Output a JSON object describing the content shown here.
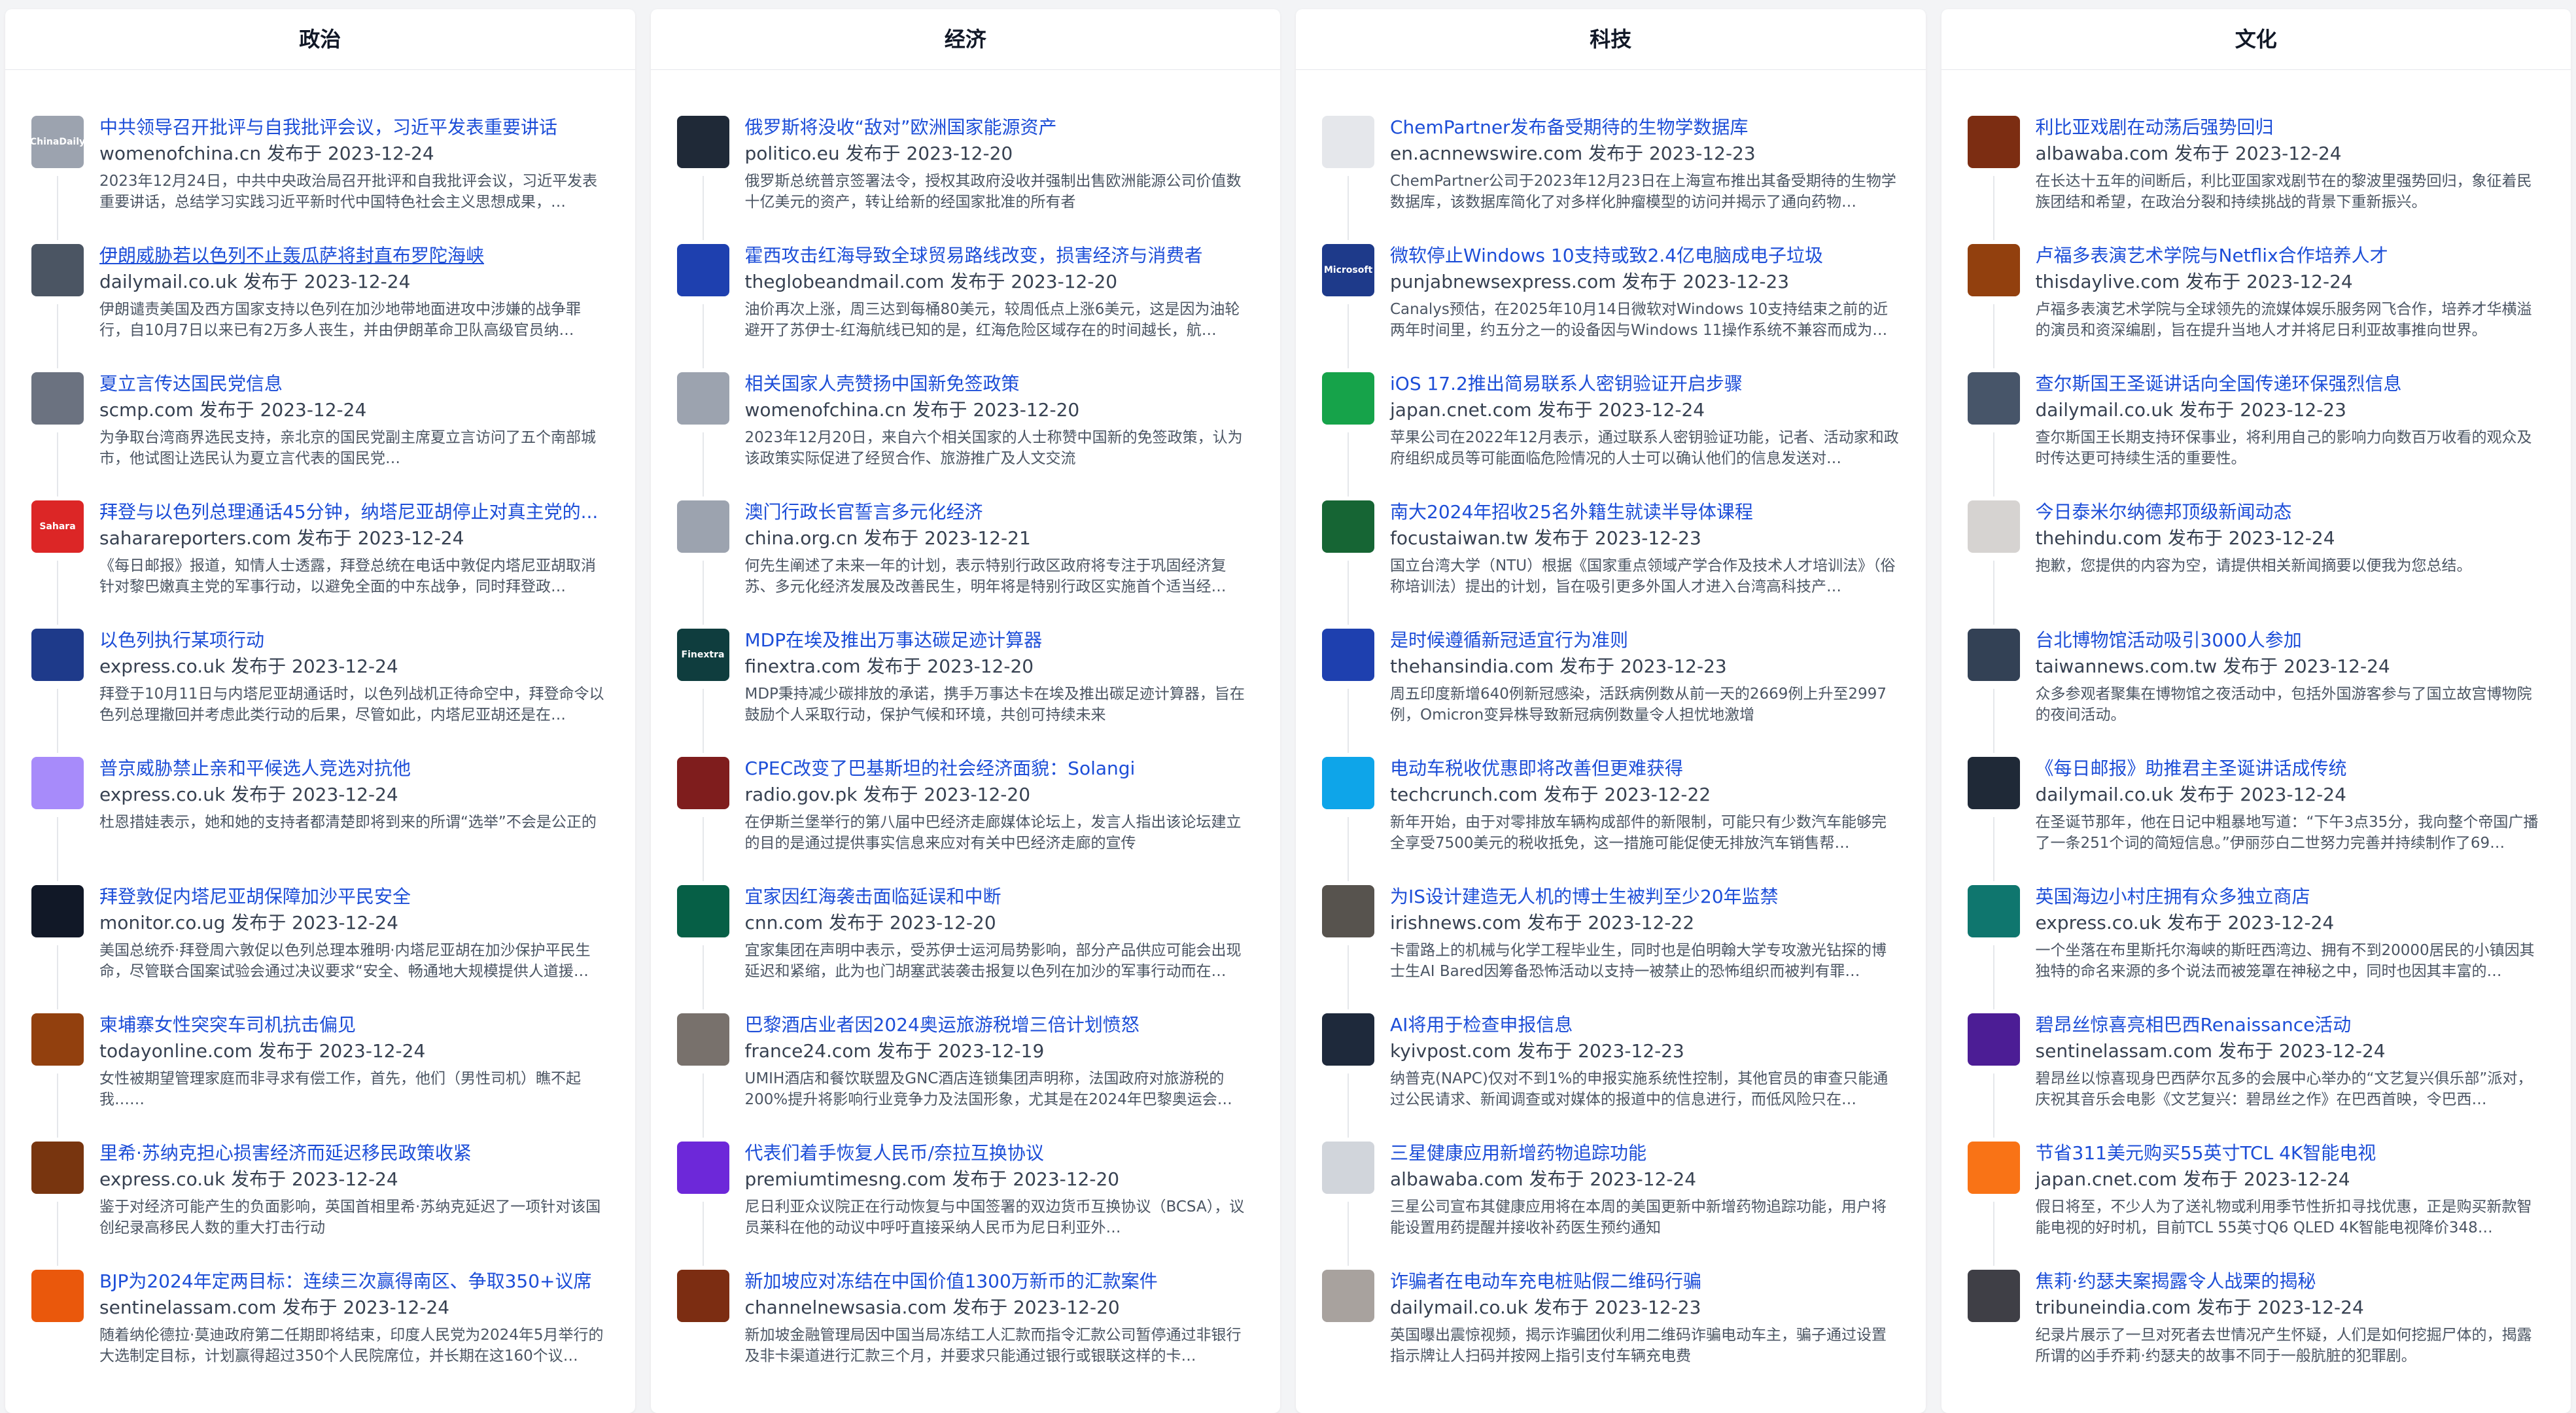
{
  "columns": [
    {
      "title": "政治",
      "items": [
        {
          "title": "中共领导召开批评与自我批评会议，习近平发表重要讲话",
          "source": "womenofchina.cn",
          "date_prefix": "发布于",
          "date": "2023-12-24",
          "summary": "2023年12月24日，中共中央政治局召开批评和自我批评会议，习近平发表重要讲话，总结学习实践习近平新时代中国特色社会主义思想成果，…",
          "thumb_color": "#9ca3af",
          "thumb_text": "ChinaDaily"
        },
        {
          "title": "伊朗威胁若以色列不止轰瓜萨将封直布罗陀海峡",
          "source": "dailymail.co.uk",
          "date_prefix": "发布于",
          "date": "2023-12-24",
          "summary": "伊朗谴责美国及西方国家支持以色列在加沙地带地面进攻中涉嫌的战争罪行，自10月7日以来已有2万多人丧生，并由伊朗革命卫队高级官员纳…",
          "thumb_color": "#4b5563",
          "thumb_text": ""
        },
        {
          "title": "夏立言传达国民党信息",
          "source": "scmp.com",
          "date_prefix": "发布于",
          "date": "2023-12-24",
          "summary": "为争取台湾商界选民支持，亲北京的国民党副主席夏立言访问了五个南部城市，他试图让选民认为夏立言代表的国民党…",
          "thumb_color": "#6b7280",
          "thumb_text": ""
        },
        {
          "title": "拜登与以色列总理通话45分钟，纳塔尼亚胡停止对真主党的...",
          "source": "saharareporters.com",
          "date_prefix": "发布于",
          "date": "2023-12-24",
          "summary": "《每日邮报》报道，知情人士透露，拜登总统在电话中敦促内塔尼亚胡取消针对黎巴嫩真主党的军事行动，以避免全面的中东战争，同时拜登政…",
          "thumb_color": "#dc2626",
          "thumb_text": "Sahara"
        },
        {
          "title": "以色列执行某项行动",
          "source": "express.co.uk",
          "date_prefix": "发布于",
          "date": "2023-12-24",
          "summary": "拜登于10月11日与内塔尼亚胡通话时，以色列战机正待命空中，拜登命令以色列总理撤回并考虑此类行动的后果，尽管如此，内塔尼亚胡还是在…",
          "thumb_color": "#1e3a8a",
          "thumb_text": ""
        },
        {
          "title": "普京威胁禁止亲和平候选人竞选对抗他",
          "source": "express.co.uk",
          "date_prefix": "发布于",
          "date": "2023-12-24",
          "summary": "杜恩措娃表示，她和她的支持者都清楚即将到来的所谓“选举”不会是公正的",
          "thumb_color": "#a78bfa",
          "thumb_text": ""
        },
        {
          "title": "拜登敦促内塔尼亚胡保障加沙平民安全",
          "source": "monitor.co.ug",
          "date_prefix": "发布于",
          "date": "2023-12-24",
          "summary": "美国总统乔·拜登周六敦促以色列总理本雅明·内塔尼亚胡在加沙保护平民生命，尽管联合国案试验会通过决议要求“安全、畅通地大规模提供人道援…",
          "thumb_color": "#111827",
          "thumb_text": ""
        },
        {
          "title": "柬埔寨女性突突车司机抗击偏见",
          "source": "todayonline.com",
          "date_prefix": "发布于",
          "date": "2023-12-24",
          "summary": "女性被期望管理家庭而非寻求有偿工作，首先，他们（男性司机）瞧不起我……",
          "thumb_color": "#92400e",
          "thumb_text": ""
        },
        {
          "title": "里希·苏纳克担心损害经济而延迟移民政策收紧",
          "source": "express.co.uk",
          "date_prefix": "发布于",
          "date": "2023-12-24",
          "summary": "鉴于对经济可能产生的负面影响，英国首相里希·苏纳克延迟了一项针对该国创纪录高移民人数的重大打击行动",
          "thumb_color": "#78350f",
          "thumb_text": ""
        },
        {
          "title": "BJP为2024年定两目标：连续三次赢得南区、争取350+议席",
          "source": "sentinelassam.com",
          "date_prefix": "发布于",
          "date": "2023-12-24",
          "summary": "随着纳伦德拉·莫迪政府第二任期即将结束，印度人民党为2024年5月举行的大选制定目标，计划赢得超过350个人民院席位，并长期在这160个议…",
          "thumb_color": "#ea580c",
          "thumb_text": ""
        }
      ]
    },
    {
      "title": "经济",
      "items": [
        {
          "title": "俄罗斯将没收“敌对”欧洲国家能源资产",
          "source": "politico.eu",
          "date_prefix": "发布于",
          "date": "2023-12-20",
          "summary": "俄罗斯总统普京签署法令，授权其政府没收并强制出售欧洲能源公司价值数十亿美元的资产，转让给新的经国家批准的所有者",
          "thumb_color": "#1f2937",
          "thumb_text": ""
        },
        {
          "title": "霍西攻击红海导致全球贸易路线改变，损害经济与消费者",
          "source": "theglobeandmail.com",
          "date_prefix": "发布于",
          "date": "2023-12-20",
          "summary": "油价再次上涨，周三达到每桶80美元，较周低点上涨6美元，这是因为油轮避开了苏伊士-红海航线已知的是，红海危险区域存在的时间越长，航…",
          "thumb_color": "#1e40af",
          "thumb_text": ""
        },
        {
          "title": "相关国家人壳赞扬中国新免签政策",
          "source": "womenofchina.cn",
          "date_prefix": "发布于",
          "date": "2023-12-20",
          "summary": "2023年12月20日，来自六个相关国家的人士称赞中国新的免签政策，认为该政策实际促进了经贸合作、旅游推广及人文交流",
          "thumb_color": "#9ca3af",
          "thumb_text": ""
        },
        {
          "title": "澳门行政长官誓言多元化经济",
          "source": "china.org.cn",
          "date_prefix": "发布于",
          "date": "2023-12-21",
          "summary": "何先生阐述了未来一年的计划，表示特别行政区政府将专注于巩固经济复苏、多元化经济发展及改善民生，明年将是特别行政区实施首个适当经…",
          "thumb_color": "#9ca3af",
          "thumb_text": ""
        },
        {
          "title": "MDP在埃及推出万事达碳足迹计算器",
          "source": "finextra.com",
          "date_prefix": "发布于",
          "date": "2023-12-20",
          "summary": "MDP秉持减少碳排放的承诺，携手万事达卡在埃及推出碳足迹计算器，旨在鼓励个人采取行动，保护气候和环境，共创可持续未来",
          "thumb_color": "#0f3d3e",
          "thumb_text": "Finextra"
        },
        {
          "title": "CPEC改变了巴基斯坦的社会经济面貌：Solangi",
          "source": "radio.gov.pk",
          "date_prefix": "发布于",
          "date": "2023-12-20",
          "summary": "在伊斯兰堡举行的第八届中巴经济走廊媒体论坛上，发言人指出该论坛建立的目的是通过提供事实信息来应对有关中巴经济走廊的宣传",
          "thumb_color": "#7f1d1d",
          "thumb_text": ""
        },
        {
          "title": "宜家因红海袭击面临延误和中断",
          "source": "cnn.com",
          "date_prefix": "发布于",
          "date": "2023-12-20",
          "summary": "宜家集团在声明中表示，受苏伊士运河局势影响，部分产品供应可能会出现延迟和紧缩，此为也门胡塞武装袭击报复以色列在加沙的军事行动而在…",
          "thumb_color": "#065f46",
          "thumb_text": ""
        },
        {
          "title": "巴黎酒店业者因2024奥运旅游税增三倍计划愤怒",
          "source": "france24.com",
          "date_prefix": "发布于",
          "date": "2023-12-19",
          "summary": "UMIH酒店和餐饮联盟及GNC酒店连锁集团声明称，法国政府对旅游税的200%提升将影响行业竞争力及法国形象，尤其是在2024年巴黎奥运会…",
          "thumb_color": "#78716c",
          "thumb_text": ""
        },
        {
          "title": "代表们着手恢复人民币/奈拉互换协议",
          "source": "premiumtimesng.com",
          "date_prefix": "发布于",
          "date": "2023-12-20",
          "summary": "尼日利亚众议院正在行动恢复与中国签署的双边货币互换协议（BCSA），议员莱科在他的动议中呼吁直接采纳人民币为尼日利亚外…",
          "thumb_color": "#6d28d9",
          "thumb_text": ""
        },
        {
          "title": "新加坡应对冻结在中国价值1300万新币的汇款案件",
          "source": "channelnewsasia.com",
          "date_prefix": "发布于",
          "date": "2023-12-20",
          "summary": "新加坡金融管理局因中国当局冻结工人汇款而指令汇款公司暂停通过非银行及非卡渠道进行汇款三个月，并要求只能通过银行或银联这样的卡…",
          "thumb_color": "#7c2d12",
          "thumb_text": ""
        }
      ]
    },
    {
      "title": "科技",
      "items": [
        {
          "title": "ChemPartner发布备受期待的生物学数据库",
          "source": "en.acnnewswire.com",
          "date_prefix": "发布于",
          "date": "2023-12-23",
          "summary": "ChemPartner公司于2023年12月23日在上海宣布推出其备受期待的生物学数据库，该数据库简化了对多样化肿瘤模型的访问并揭示了通向药物…",
          "thumb_color": "#e5e7eb",
          "thumb_text": ""
        },
        {
          "title": "微软停止Windows 10支持或致2.4亿电脑成电子垃圾",
          "source": "punjabnewsexpress.com",
          "date_prefix": "发布于",
          "date": "2023-12-23",
          "summary": "Canalys预估，在2025年10月14日微软对Windows 10支持结束之前的近两年时间里，约五分之一的设备因与Windows 11操作系统不兼容而成为…",
          "thumb_color": "#1e3a8a",
          "thumb_text": "Microsoft"
        },
        {
          "title": "iOS 17.2推出简易联系人密钥验证开启步骤",
          "source": "japan.cnet.com",
          "date_prefix": "发布于",
          "date": "2023-12-24",
          "summary": "苹果公司在2022年12月表示，通过联系人密钥验证功能，记者、活动家和政府组织成员等可能面临危险情况的人士可以确认他们的信息发送对…",
          "thumb_color": "#16a34a",
          "thumb_text": ""
        },
        {
          "title": "南大2024年招收25名外籍生就读半导体课程",
          "source": "focustaiwan.tw",
          "date_prefix": "发布于",
          "date": "2023-12-23",
          "summary": "国立台湾大学（NTU）根据《国家重点领域产学合作及技术人才培训法》（俗称培训法）提出的计划，旨在吸引更多外国人才进入台湾高科技产…",
          "thumb_color": "#166534",
          "thumb_text": ""
        },
        {
          "title": "是时候遵循新冠适宜行为准则",
          "source": "thehansindia.com",
          "date_prefix": "发布于",
          "date": "2023-12-23",
          "summary": "周五印度新增640例新冠感染，活跃病例数从前一天的2669例上升至2997例，Omicron变异株导致新冠病例数量令人担忧地激增",
          "thumb_color": "#1e40af",
          "thumb_text": ""
        },
        {
          "title": "电动车税收优惠即将改善但更难获得",
          "source": "techcrunch.com",
          "date_prefix": "发布于",
          "date": "2023-12-22",
          "summary": "新年开始，由于对零排放车辆构成部件的新限制，可能只有少数汽车能够完全享受7500美元的税收抵免，这一措施可能促使无排放汽车销售帮…",
          "thumb_color": "#0ea5e9",
          "thumb_text": ""
        },
        {
          "title": "为IS设计建造无人机的博士生被判至少20年监禁",
          "source": "irishnews.com",
          "date_prefix": "发布于",
          "date": "2023-12-22",
          "summary": "卡雷路上的机械与化学工程毕业生，同时也是伯明翰大学专攻激光钻探的博士生AI Bared因筹备恐怖活动以支持一被禁止的恐怖组织而被判有罪…",
          "thumb_color": "#57534e",
          "thumb_text": ""
        },
        {
          "title": "AI将用于检查申报信息",
          "source": "kyivpost.com",
          "date_prefix": "发布于",
          "date": "2023-12-23",
          "summary": "纳普克(NAPC)仅对不到1%的申报实施系统性控制，其他官员的审查只能通过公民请求、新闻调查或对媒体的报道中的信息进行，而低风险只在…",
          "thumb_color": "#1e293b",
          "thumb_text": ""
        },
        {
          "title": "三星健康应用新增药物追踪功能",
          "source": "albawaba.com",
          "date_prefix": "发布于",
          "date": "2023-12-24",
          "summary": "三星公司宣布其健康应用将在本周的美国更新中新增药物追踪功能，用户将能设置用药提醒并接收补药医生预约通知",
          "thumb_color": "#d1d5db",
          "thumb_text": ""
        },
        {
          "title": "诈骗者在电动车充电桩贴假二维码行骗",
          "source": "dailymail.co.uk",
          "date_prefix": "发布于",
          "date": "2023-12-23",
          "summary": "英国曝出震惊视频，揭示诈骗团伙利用二维码诈骗电动车主，骗子通过设置指示牌让人扫码并按网上指引支付车辆充电费",
          "thumb_color": "#a8a29e",
          "thumb_text": ""
        }
      ]
    },
    {
      "title": "文化",
      "items": [
        {
          "title": "利比亚戏剧在动荡后强势回归",
          "source": "albawaba.com",
          "date_prefix": "发布于",
          "date": "2023-12-24",
          "summary": "在长达十五年的间断后，利比亚国家戏剧节在的黎波里强势回归，象征着民族团结和希望，在政治分裂和持续挑战的背景下重新振兴。",
          "thumb_color": "#7c2d12",
          "thumb_text": ""
        },
        {
          "title": "卢福多表演艺术学院与Netflix合作培养人才",
          "source": "thisdaylive.com",
          "date_prefix": "发布于",
          "date": "2023-12-24",
          "summary": "卢福多表演艺术学院与全球领先的流媒体娱乐服务网飞合作，培养才华横溢的演员和资深编剧，旨在提升当地人才并将尼日利亚故事推向世界。",
          "thumb_color": "#92400e",
          "thumb_text": ""
        },
        {
          "title": "查尔斯国王圣诞讲话向全国传递环保强烈信息",
          "source": "dailymail.co.uk",
          "date_prefix": "发布于",
          "date": "2023-12-23",
          "summary": "查尔斯国王长期支持环保事业，将利用自己的影响力向数百万收看的观众及时传达更可持续生活的重要性。",
          "thumb_color": "#475569",
          "thumb_text": ""
        },
        {
          "title": "今日泰米尔纳德邦顶级新闻动态",
          "source": "thehindu.com",
          "date_prefix": "发布于",
          "date": "2023-12-24",
          "summary": "抱歉，您提供的内容为空，请提供相关新闻摘要以便我为您总结。",
          "thumb_color": "#d6d3d1",
          "thumb_text": ""
        },
        {
          "title": "台北博物馆活动吸引3000人参加",
          "source": "taiwannews.com.tw",
          "date_prefix": "发布于",
          "date": "2023-12-24",
          "summary": "众多参观者聚集在博物馆之夜活动中，包括外国游客参与了国立故宫博物院的夜间活动。",
          "thumb_color": "#334155",
          "thumb_text": ""
        },
        {
          "title": "《每日邮报》助推君主圣诞讲话成传统",
          "source": "dailymail.co.uk",
          "date_prefix": "发布于",
          "date": "2023-12-24",
          "summary": "在圣诞节那年，他在日记中粗暴地写道：“下午3点35分，我向整个帝国广播了一条251个词的简短信息。”伊丽莎白二世努力完善并持续制作了69…",
          "thumb_color": "#1f2937",
          "thumb_text": ""
        },
        {
          "title": "英国海边小村庄拥有众多独立商店",
          "source": "express.co.uk",
          "date_prefix": "发布于",
          "date": "2023-12-24",
          "summary": "一个坐落在布里斯托尔海峡的斯旺西湾边、拥有不到20000居民的小镇因其独特的命名来源的多个说法而被笼罩在神秘之中，同时也因其丰富的…",
          "thumb_color": "#0f766e",
          "thumb_text": ""
        },
        {
          "title": "碧昂丝惊喜亮相巴西Renaissance活动",
          "source": "sentinelassam.com",
          "date_prefix": "发布于",
          "date": "2023-12-24",
          "summary": "碧昂丝以惊喜现身巴西萨尔瓦多的会展中心举办的“文艺复兴俱乐部”派对，庆祝其音乐会电影《文艺复兴：碧昂丝之作》在巴西首映，令巴西…",
          "thumb_color": "#4c1d95",
          "thumb_text": ""
        },
        {
          "title": "节省311美元购买55英寸TCL 4K智能电视",
          "source": "japan.cnet.com",
          "date_prefix": "发布于",
          "date": "2023-12-24",
          "summary": "假日将至，不少人为了送礼物或利用季节性折扣寻找优惠，正是购买新款智能电视的好时机，目前TCL 55英寸Q6 QLED 4K智能电视降价348…",
          "thumb_color": "#f97316",
          "thumb_text": ""
        },
        {
          "title": "焦莉·约瑟夫案揭露令人战栗的揭秘",
          "source": "tribuneindia.com",
          "date_prefix": "发布于",
          "date": "2023-12-24",
          "summary": "纪录片展示了一旦对死者去世情况产生怀疑，人们是如何挖掘尸体的，揭露所谓的凶手乔莉·约瑟夫的故事不同于一般肮脏的犯罪剧。",
          "thumb_color": "#3f3f46",
          "thumb_text": ""
        }
      ]
    }
  ]
}
